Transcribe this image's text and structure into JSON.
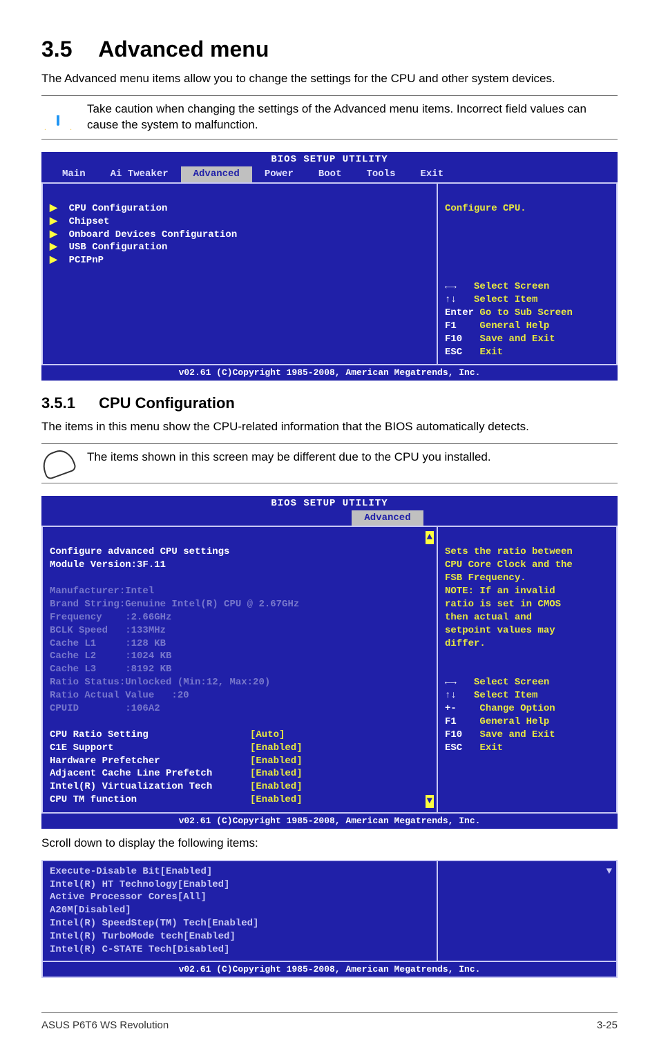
{
  "section": {
    "num": "3.5",
    "title": "Advanced menu"
  },
  "intro": "The Advanced menu items allow you to change the settings for the CPU and other system devices.",
  "caution": "Take caution when changing the settings of the Advanced menu items. Incorrect field values can cause the system to malfunction.",
  "bios1": {
    "title": "BIOS SETUP UTILITY",
    "menus": [
      "Main",
      "Ai Tweaker",
      "Advanced",
      "Power",
      "Boot",
      "Tools",
      "Exit"
    ],
    "active_menu": "Advanced",
    "left_items": [
      "CPU Configuration",
      "Chipset",
      "Onboard Devices Configuration",
      "USB Configuration",
      "PCIPnP"
    ],
    "right_top": "Configure CPU.",
    "keys": [
      {
        "k": "←→",
        "v": "Select Screen"
      },
      {
        "k": "↑↓",
        "v": "Select Item"
      },
      {
        "k": "Enter",
        "v": "Go to Sub Screen"
      },
      {
        "k": "F1",
        "v": "General Help"
      },
      {
        "k": "F10",
        "v": "Save and Exit"
      },
      {
        "k": "ESC",
        "v": "Exit"
      }
    ],
    "footer": "v02.61 (C)Copyright 1985-2008, American Megatrends, Inc."
  },
  "subsection": {
    "num": "3.5.1",
    "title": "CPU Configuration"
  },
  "sub_intro": "The items in this menu show the CPU-related information that the BIOS automatically detects.",
  "note": "The items shown in this screen may be different due to the CPU you installed.",
  "bios2": {
    "title": "BIOS SETUP UTILITY",
    "menus": [
      "Advanced"
    ],
    "header1": "Configure advanced CPU settings",
    "header2": "Module Version:3F.11",
    "info_lines": [
      "Manufacturer:Intel",
      "Brand String:Genuine Intel(R) CPU @ 2.67GHz",
      "Frequency    :2.66GHz",
      "BCLK Speed   :133MHz",
      "Cache L1     :128 KB",
      "Cache L2     :1024 KB",
      "Cache L3     :8192 KB",
      "Ratio Status:Unlocked (Min:12, Max:20)",
      "Ratio Actual Value   :20",
      "CPUID        :106A2"
    ],
    "settings": [
      {
        "lbl": "CPU Ratio Setting",
        "val": "[Auto]"
      },
      {
        "lbl": "C1E Support",
        "val": "[Enabled]"
      },
      {
        "lbl": "Hardware Prefetcher",
        "val": "[Enabled]"
      },
      {
        "lbl": "Adjacent Cache Line Prefetch",
        "val": "[Enabled]"
      },
      {
        "lbl": "Intel(R) Virtualization Tech",
        "val": "[Enabled]"
      },
      {
        "lbl": "CPU TM function",
        "val": "[Enabled]"
      }
    ],
    "right_help": "Sets the ratio between\nCPU Core Clock and the\nFSB Frequency.\nNOTE: If an invalid\nratio is set in CMOS\nthen actual and\nsetpoint values may\ndiffer.",
    "keys": [
      {
        "k": "←→",
        "v": "Select Screen"
      },
      {
        "k": "↑↓",
        "v": "Select Item"
      },
      {
        "k": "+-",
        "v": "Change Option"
      },
      {
        "k": "F1",
        "v": "General Help"
      },
      {
        "k": "F10",
        "v": "Save and Exit"
      },
      {
        "k": "ESC",
        "v": "Exit"
      }
    ],
    "footer": "v02.61 (C)Copyright 1985-2008, American Megatrends, Inc."
  },
  "scroll_label": "Scroll down to display the following items:",
  "scrollfrag": {
    "settings": [
      {
        "lbl": "Execute-Disable Bit",
        "val": "[Enabled]"
      },
      {
        "lbl": "Intel(R) HT Technology",
        "val": "[Enabled]"
      },
      {
        "lbl": "Active Processor Cores",
        "val": "[All]"
      },
      {
        "lbl": "A20M",
        "val": "[Disabled]"
      },
      {
        "lbl": "Intel(R) SpeedStep(TM) Tech",
        "val": "[Enabled]"
      },
      {
        "lbl": "Intel(R) TurboMode tech",
        "val": "[Enabled]"
      },
      {
        "lbl": "Intel(R) C-STATE Tech",
        "val": "[Disabled]"
      }
    ],
    "footer": "v02.61 (C)Copyright 1985-2008, American Megatrends, Inc."
  },
  "page_footer_left": "ASUS P6T6 WS Revolution",
  "page_footer_right": "3-25"
}
